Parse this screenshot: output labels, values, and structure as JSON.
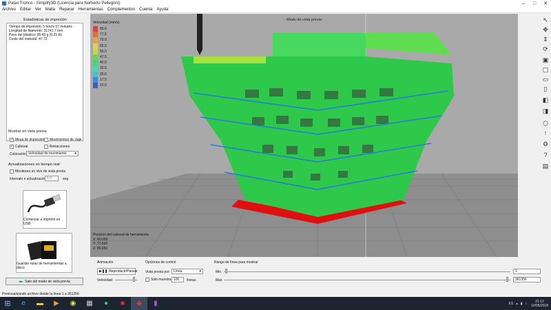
{
  "window": {
    "title": "Patas Tronco - Simplify3D (Licencia para Norberto Pellegrini)"
  },
  "menu": [
    "Archivo",
    "Editar",
    "Ver",
    "Malla",
    "Reparar",
    "Herramientas",
    "Complementos",
    "Cuenta",
    "Ayuda"
  ],
  "stats": {
    "title": "Estadísticas de impresión",
    "lines": [
      "Tiempo de impresión: 5 hours 57 minutes",
      "Longitud de filamento: 31741.7 mm",
      "Peso del plástico: 95.43 g (0.21 lb)",
      "Coste del material: 47.72"
    ]
  },
  "preview": {
    "title": "Mostrar en vista previa",
    "checkboxes": [
      {
        "label": "Mesa de impresión",
        "checked": true
      },
      {
        "label": "Movimientos de viaje",
        "checked": false
      },
      {
        "label": "Cabezal",
        "checked": true
      },
      {
        "label": "Retracciones",
        "checked": false
      }
    ],
    "coloring_label": "Coloración",
    "coloring_value": "Velocidad de movimiento"
  },
  "realtime": {
    "title": "Actualizaciones en tiempo real",
    "monitor_label": "Monitoreo en vivo de vista previa",
    "interval_label": "Intervalo e actualización",
    "interval_value": "5.0",
    "interval_unit": "seg"
  },
  "usb_button": "Comenzar a imprimir en USB",
  "sd_button": "Guardar rutas de herramientas a disco",
  "exit_button": "Salir del modo de vista previa",
  "viewport": {
    "title": "Modo de vista previa",
    "legend_title": "Velocidad (mm/s)",
    "legend": [
      {
        "value": "85.0",
        "color": "#e83c3c"
      },
      {
        "value": "77.5",
        "color": "#ea6a3a"
      },
      {
        "value": "70.0",
        "color": "#eda040"
      },
      {
        "value": "62.5",
        "color": "#e8d040"
      },
      {
        "value": "55.0",
        "color": "#b8e040"
      },
      {
        "value": "47.5",
        "color": "#60e040"
      },
      {
        "value": "40.0",
        "color": "#30e070"
      },
      {
        "value": "32.5",
        "color": "#30e0b0"
      },
      {
        "value": "25.0",
        "color": "#30c8e0"
      },
      {
        "value": "17.5",
        "color": "#3090e0"
      },
      {
        "value": "10.0",
        "color": "#3060d8"
      }
    ],
    "toolhead_title": "Posición del cabezal de herramienta",
    "toolhead": [
      "X: 80.000",
      "Y: 71.600",
      "Z: 85.050"
    ]
  },
  "bottom": {
    "animation_title": "Animación",
    "play_label": "Reproducir/Pausar",
    "speed_label": "Velocidad:",
    "control_title": "Opciones de control",
    "preview_by_label": "Vista previa por:",
    "preview_by_value": "Línea",
    "single_layer_label": "Solo muestra",
    "single_layer_value": "100",
    "single_layer_unit": "líneas",
    "range_title": "Rango de línea para mostrar",
    "min_label": "Min",
    "max_label": "Max",
    "min_value": "1",
    "max_value": "361356"
  },
  "status": "Previsualizando archivo desde la línea 1 a 361356",
  "taskbar": {
    "lang": "ES",
    "time": "21:12",
    "date": "10/06/2018"
  }
}
